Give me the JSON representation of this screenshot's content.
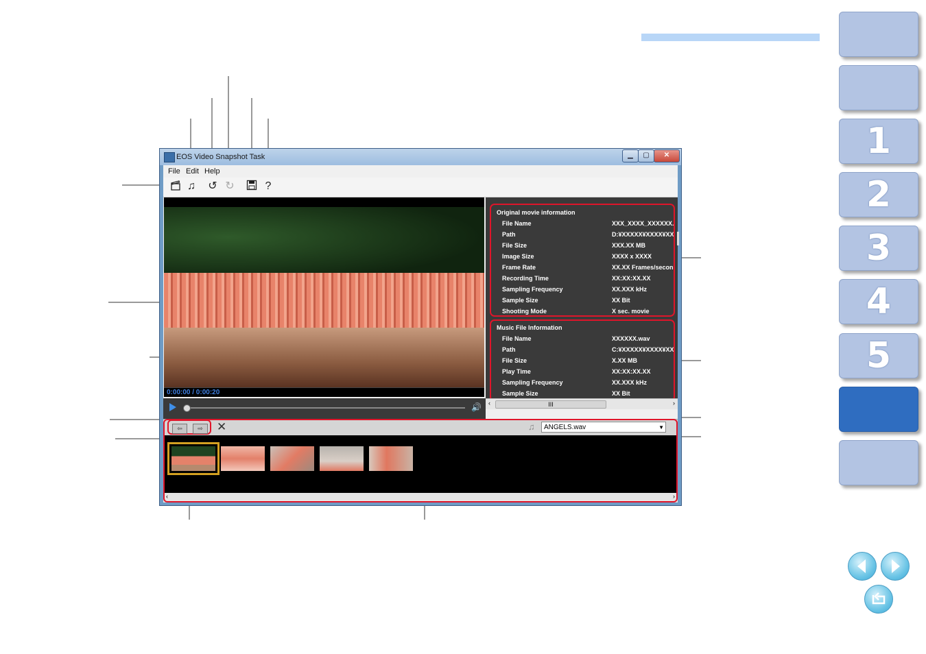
{
  "window": {
    "title": "EOS Video Snapshot Task",
    "controls": {
      "minimize": "▁",
      "maximize": "▢",
      "close": "✕"
    }
  },
  "menu": {
    "file": "File",
    "edit": "Edit",
    "help": "Help"
  },
  "toolbar": {
    "icons": [
      "movie-icon",
      "music-note-icon",
      "undo-icon",
      "redo-icon",
      "save-icon",
      "help-icon"
    ],
    "help_glyph": "?"
  },
  "player": {
    "timecode": "0:00:00 / 0:00:20"
  },
  "original_movie_info": {
    "title": "Original movie information",
    "rows": [
      {
        "label": "File Name",
        "value": "XXX_XXXX_XXXXXX.M"
      },
      {
        "label": "Path",
        "value": "D:¥XXXXX¥XXXX¥XXX"
      },
      {
        "label": "File Size",
        "value": "XXX.XX MB"
      },
      {
        "label": "Image Size",
        "value": "XXXX x XXXX"
      },
      {
        "label": "Frame Rate",
        "value": "XX.XX Frames/secon"
      },
      {
        "label": "Recording Time",
        "value": "XX:XX:XX.XX"
      },
      {
        "label": "Sampling Frequency",
        "value": "XX.XXX kHz"
      },
      {
        "label": "Sample Size",
        "value": "XX Bit"
      },
      {
        "label": "Shooting Mode",
        "value": "X sec. movie"
      }
    ]
  },
  "music_file_info": {
    "title": "Music File Information",
    "rows": [
      {
        "label": "File Name",
        "value": "XXXXXX.wav"
      },
      {
        "label": "Path",
        "value": "C:¥XXXXX¥XXXX¥XXX"
      },
      {
        "label": "File Size",
        "value": "X.XX MB"
      },
      {
        "label": "Play Time",
        "value": "XX:XX:XX.XX"
      },
      {
        "label": "Sampling Frequency",
        "value": "XX.XXX kHz"
      },
      {
        "label": "Sample Size",
        "value": "XX Bit"
      }
    ]
  },
  "scrollbar": {
    "grip": "III",
    "left": "‹",
    "right": "›"
  },
  "frame_toolbar": {
    "music_select_value": "ANGELS.wav"
  },
  "nav": {
    "tabs": [
      "",
      "",
      "1",
      "2",
      "3",
      "4",
      "5",
      "",
      "",
      ""
    ],
    "active_index": 7
  },
  "colors": {
    "accent_red": "#e0152a",
    "nav_tab": "#b3c4e3",
    "nav_active": "#2f6dc0",
    "header_bar": "#b8d6f7"
  }
}
